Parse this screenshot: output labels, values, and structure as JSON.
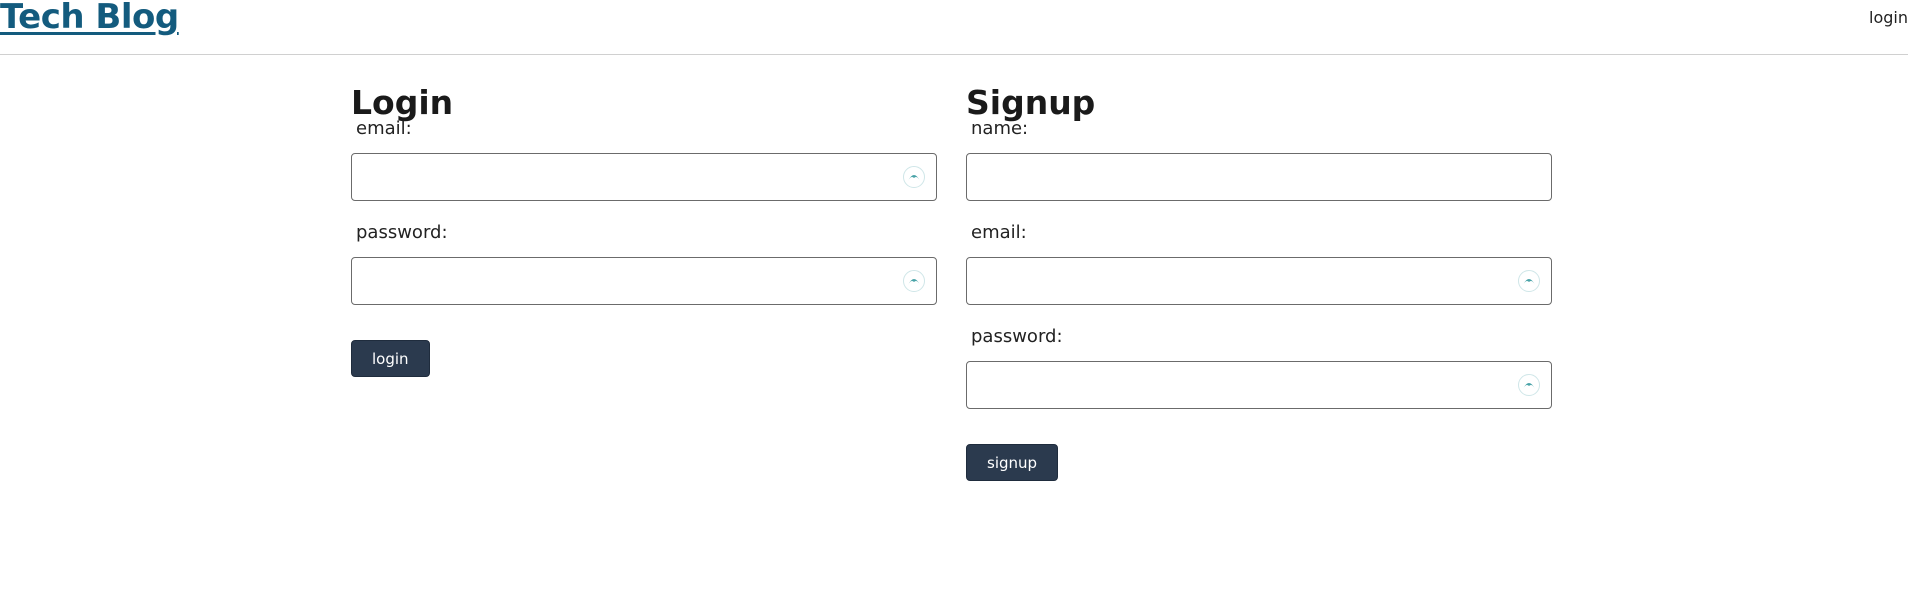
{
  "header": {
    "brand": "Tech Blog",
    "nav_login": "login"
  },
  "login": {
    "title": "Login",
    "email_label": "email:",
    "email_value": "",
    "password_label": "password:",
    "password_value": "",
    "submit_label": "login"
  },
  "signup": {
    "title": "Signup",
    "name_label": "name:",
    "name_value": "",
    "email_label": "email:",
    "email_value": "",
    "password_label": "password:",
    "password_value": "",
    "submit_label": "signup"
  },
  "icons": {
    "password_manager": "password-manager-icon"
  },
  "colors": {
    "brand": "#135b7e",
    "button_bg": "#2b3a4e",
    "icon_accent": "#4aa3a8"
  }
}
